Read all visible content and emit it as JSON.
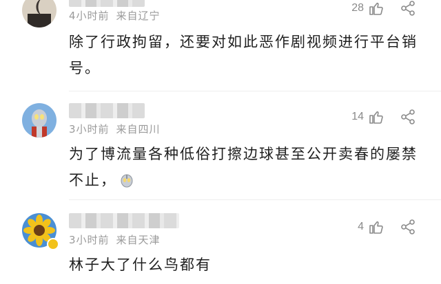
{
  "comments": [
    {
      "meta_time": "4小时前",
      "meta_loc": "来自辽宁",
      "likes": "28",
      "text": "除了行政拘留，还要对如此恶作剧视频进行平台销号。"
    },
    {
      "meta_time": "3小时前",
      "meta_loc": "来自四川",
      "likes": "14",
      "text": "为了博流量各种低俗打擦边球甚至公开卖春的屡禁不止，"
    },
    {
      "meta_time": "3小时前",
      "meta_loc": "来自天津",
      "likes": "4",
      "text": "林子大了什么鸟都有"
    }
  ],
  "icons": {
    "like": "thumbs-up-icon",
    "share": "share-icon",
    "emoji": "ultraman-emoji-icon"
  }
}
